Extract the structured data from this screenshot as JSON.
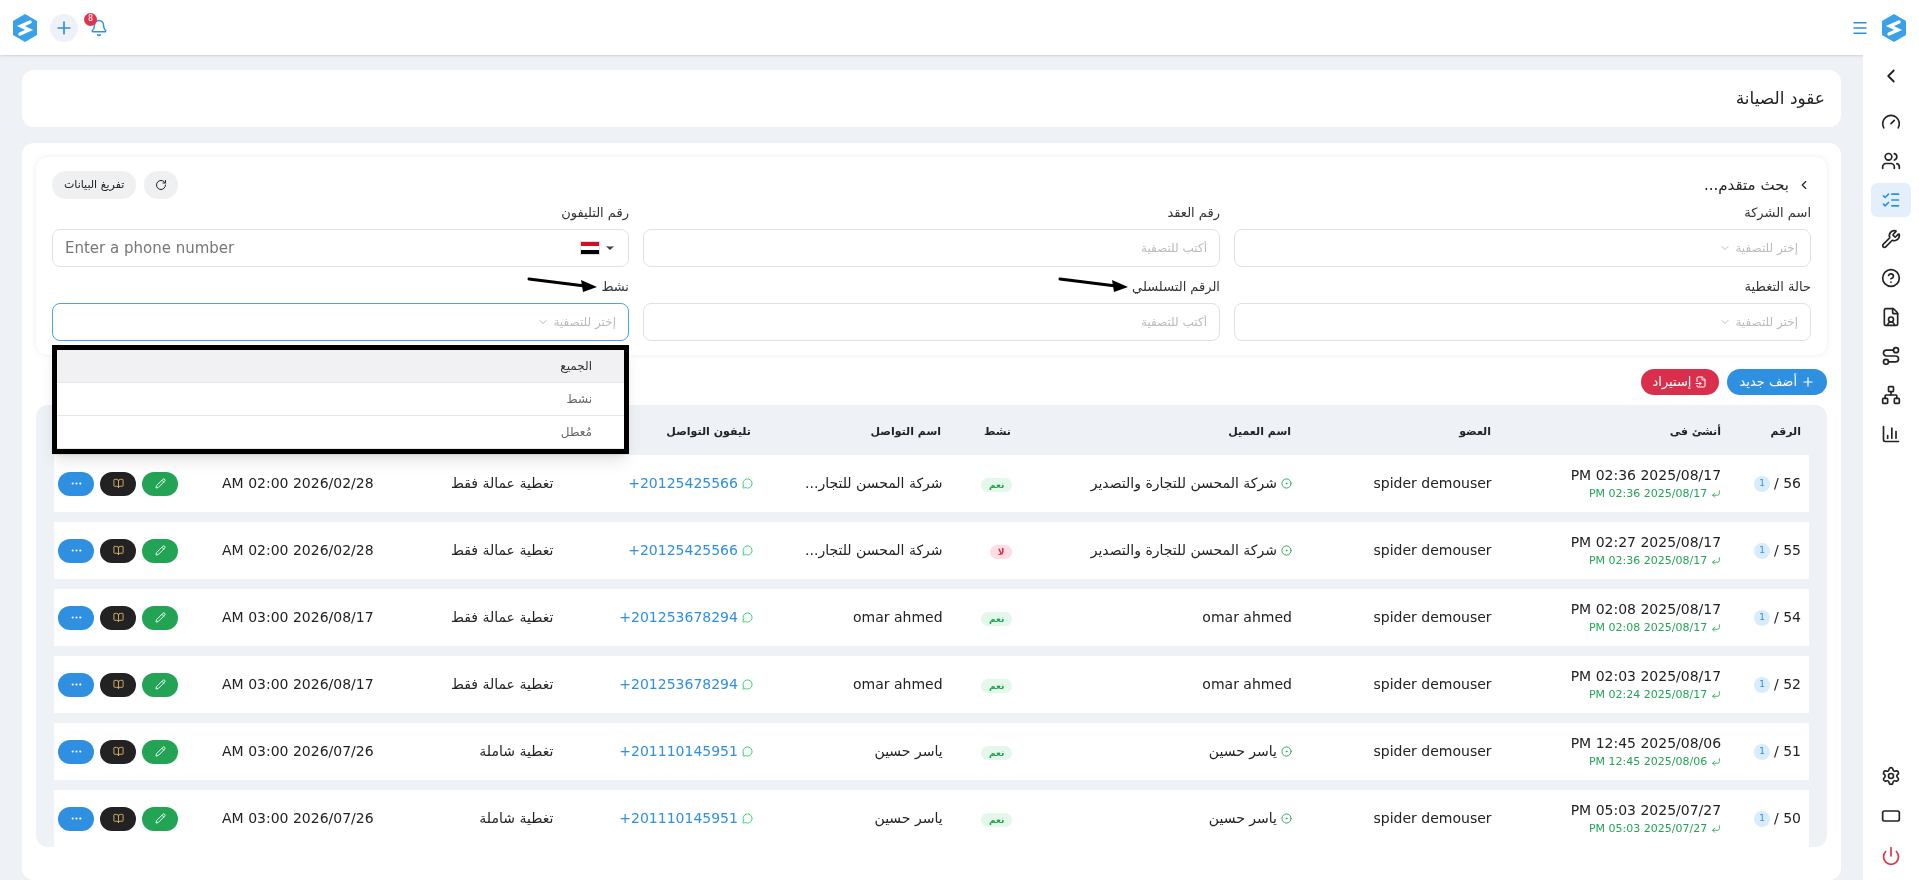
{
  "header": {
    "notification_count": "8"
  },
  "sidebar": {
    "items": [
      {
        "selected": false
      },
      {
        "selected": false
      },
      {
        "selected": true
      },
      {
        "selected": false
      },
      {
        "selected": false
      },
      {
        "selected": false
      },
      {
        "selected": false
      },
      {
        "selected": false
      },
      {
        "selected": false
      }
    ]
  },
  "page_title": "عقود الصيانة",
  "filters": {
    "title": "بحث متقدم...",
    "clear_button": "تفريغ البيانات",
    "fields": [
      {
        "kind": "select",
        "label": "اسم الشركة",
        "placeholder": "إختر للتصفية",
        "open": false,
        "annotated": false
      },
      {
        "kind": "text",
        "label": "رقم العقد",
        "placeholder": "أكتب للتصفية",
        "annotated": false
      },
      {
        "kind": "phone",
        "label": "رقم التليفون",
        "placeholder": "Enter a phone number",
        "annotated": false
      },
      {
        "kind": "select",
        "label": "حالة التغطية",
        "placeholder": "إختر للتصفية",
        "open": false,
        "annotated": false
      },
      {
        "kind": "text",
        "label": "الرقم التسلسلي",
        "placeholder": "أكتب للتصفية",
        "annotated": true
      },
      {
        "kind": "select",
        "label": "نشط",
        "placeholder": "إختر للتصفية",
        "open": true,
        "annotated": true,
        "options": [
          {
            "label": "الجميع",
            "selected": true
          },
          {
            "label": "نشط",
            "selected": false
          },
          {
            "label": "مُعطل",
            "selected": false
          }
        ]
      }
    ]
  },
  "actions": {
    "add_button": "أضف جديد",
    "import_button": "إستيراد"
  },
  "table": {
    "columns": [
      "الرقم",
      "أنشئ فى",
      "العضو",
      "اسم العميل",
      "نشط",
      "اسم التواصل",
      "تليفون التواصل"
    ],
    "rows": [
      {
        "number": "56 /",
        "badge": "1",
        "created": "PM 02:36 2025/08/17",
        "updated": "PM 02:36 2025/08/17",
        "member": "spider demouser",
        "client": "شركة المحسن للتجارة والتصدير",
        "client_linked": true,
        "active": true,
        "active_label": "نعم",
        "contact_name": "شركة المحسن للتجار...",
        "phone": "+20125425566",
        "coverage": "تغطية عمالة فقط",
        "end_date": "AM 02:00 2026/02/28"
      },
      {
        "number": "55 /",
        "badge": "1",
        "created": "PM 02:27 2025/08/17",
        "updated": "PM 02:36 2025/08/17",
        "member": "spider demouser",
        "client": "شركة المحسن للتجارة والتصدير",
        "client_linked": true,
        "active": false,
        "active_label": "لا",
        "contact_name": "شركة المحسن للتجار...",
        "phone": "+20125425566",
        "coverage": "تغطية عمالة فقط",
        "end_date": "AM 02:00 2026/02/28"
      },
      {
        "number": "54 /",
        "badge": "1",
        "created": "PM 02:08 2025/08/17",
        "updated": "PM 02:08 2025/08/17",
        "member": "spider demouser",
        "client": "omar ahmed",
        "client_linked": false,
        "active": true,
        "active_label": "نعم",
        "contact_name": "omar ahmed",
        "phone": "+201253678294",
        "coverage": "تغطية عمالة فقط",
        "end_date": "AM 03:00 2026/08/17"
      },
      {
        "number": "52 /",
        "badge": "1",
        "created": "PM 02:03 2025/08/17",
        "updated": "PM 02:24 2025/08/17",
        "member": "spider demouser",
        "client": "omar ahmed",
        "client_linked": false,
        "active": true,
        "active_label": "نعم",
        "contact_name": "omar ahmed",
        "phone": "+201253678294",
        "coverage": "تغطية عمالة فقط",
        "end_date": "AM 03:00 2026/08/17"
      },
      {
        "number": "51 /",
        "badge": "1",
        "created": "PM 12:45 2025/08/06",
        "updated": "PM 12:45 2025/08/06",
        "member": "spider demouser",
        "client": "ياسر حسين",
        "client_linked": true,
        "active": true,
        "active_label": "نعم",
        "contact_name": "ياسر حسين",
        "phone": "+201110145951",
        "coverage": "تغطية شاملة",
        "end_date": "AM 03:00 2026/07/26"
      },
      {
        "number": "50 /",
        "badge": "1",
        "created": "PM 05:03 2025/07/27",
        "updated": "PM 05:03 2025/07/27",
        "member": "spider demouser",
        "client": "ياسر حسين",
        "client_linked": true,
        "active": true,
        "active_label": "نعم",
        "contact_name": "ياسر حسين",
        "phone": "+201110145951",
        "coverage": "تغطية شاملة",
        "end_date": "AM 03:00 2026/07/26"
      }
    ]
  }
}
